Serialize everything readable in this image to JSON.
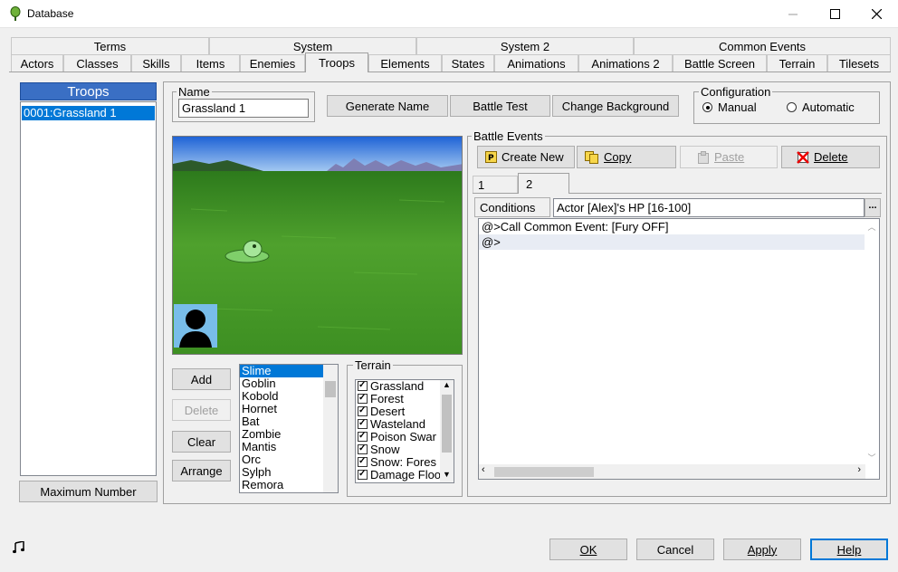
{
  "window": {
    "title": "Database",
    "minimize": "─",
    "maximize": "☐",
    "close": "✕"
  },
  "tabs_row1": [
    "Terms",
    "System",
    "System 2",
    "Common Events"
  ],
  "tabs_row2": [
    "Actors",
    "Classes",
    "Skills",
    "Items",
    "Enemies",
    "Troops",
    "Elements",
    "States",
    "Animations",
    "Animations 2",
    "Battle Screen",
    "Terrain",
    "Tilesets"
  ],
  "active_tab": "Troops",
  "troops_panel": {
    "header": "Troops",
    "items": [
      "0001:Grassland 1"
    ],
    "max_button": "Maximum Number"
  },
  "name_group": {
    "label": "Name",
    "value": "Grassland 1"
  },
  "buttons": {
    "generate_name": "Generate Name",
    "battle_test": "Battle Test",
    "change_background": "Change Background"
  },
  "configuration": {
    "label": "Configuration",
    "options": [
      "Manual",
      "Automatic"
    ],
    "selected": "Manual"
  },
  "enemy_buttons": {
    "add": "Add",
    "delete": "Delete",
    "clear": "Clear",
    "arrange": "Arrange"
  },
  "enemies_list": [
    "Slime",
    "Goblin",
    "Kobold",
    "Hornet",
    "Bat",
    "Zombie",
    "Mantis",
    "Orc",
    "Sylph",
    "Remora"
  ],
  "enemies_selected": "Slime",
  "terrain": {
    "label": "Terrain",
    "items": [
      "Grassland",
      "Forest",
      "Desert",
      "Wasteland",
      "Poison Swar",
      "Snow",
      "Snow: Fores",
      "Damage Floo"
    ]
  },
  "battle_events": {
    "label": "Battle Events",
    "create_new": "Create New",
    "copy": "Copy",
    "paste": "Paste",
    "delete": "Delete",
    "pages": [
      "1",
      "2"
    ],
    "active_page": "2",
    "conditions_label": "Conditions",
    "conditions_value": "Actor [Alex]'s HP [16-100]",
    "ellipsis": "...",
    "commands": [
      "@>Call Common Event: [Fury OFF]",
      "@>"
    ]
  },
  "footer": {
    "ok": "OK",
    "cancel": "Cancel",
    "apply": "Apply",
    "help": "Help"
  },
  "colors": {
    "accent": "#0078d7",
    "troops_header": "#3a6fc4"
  }
}
